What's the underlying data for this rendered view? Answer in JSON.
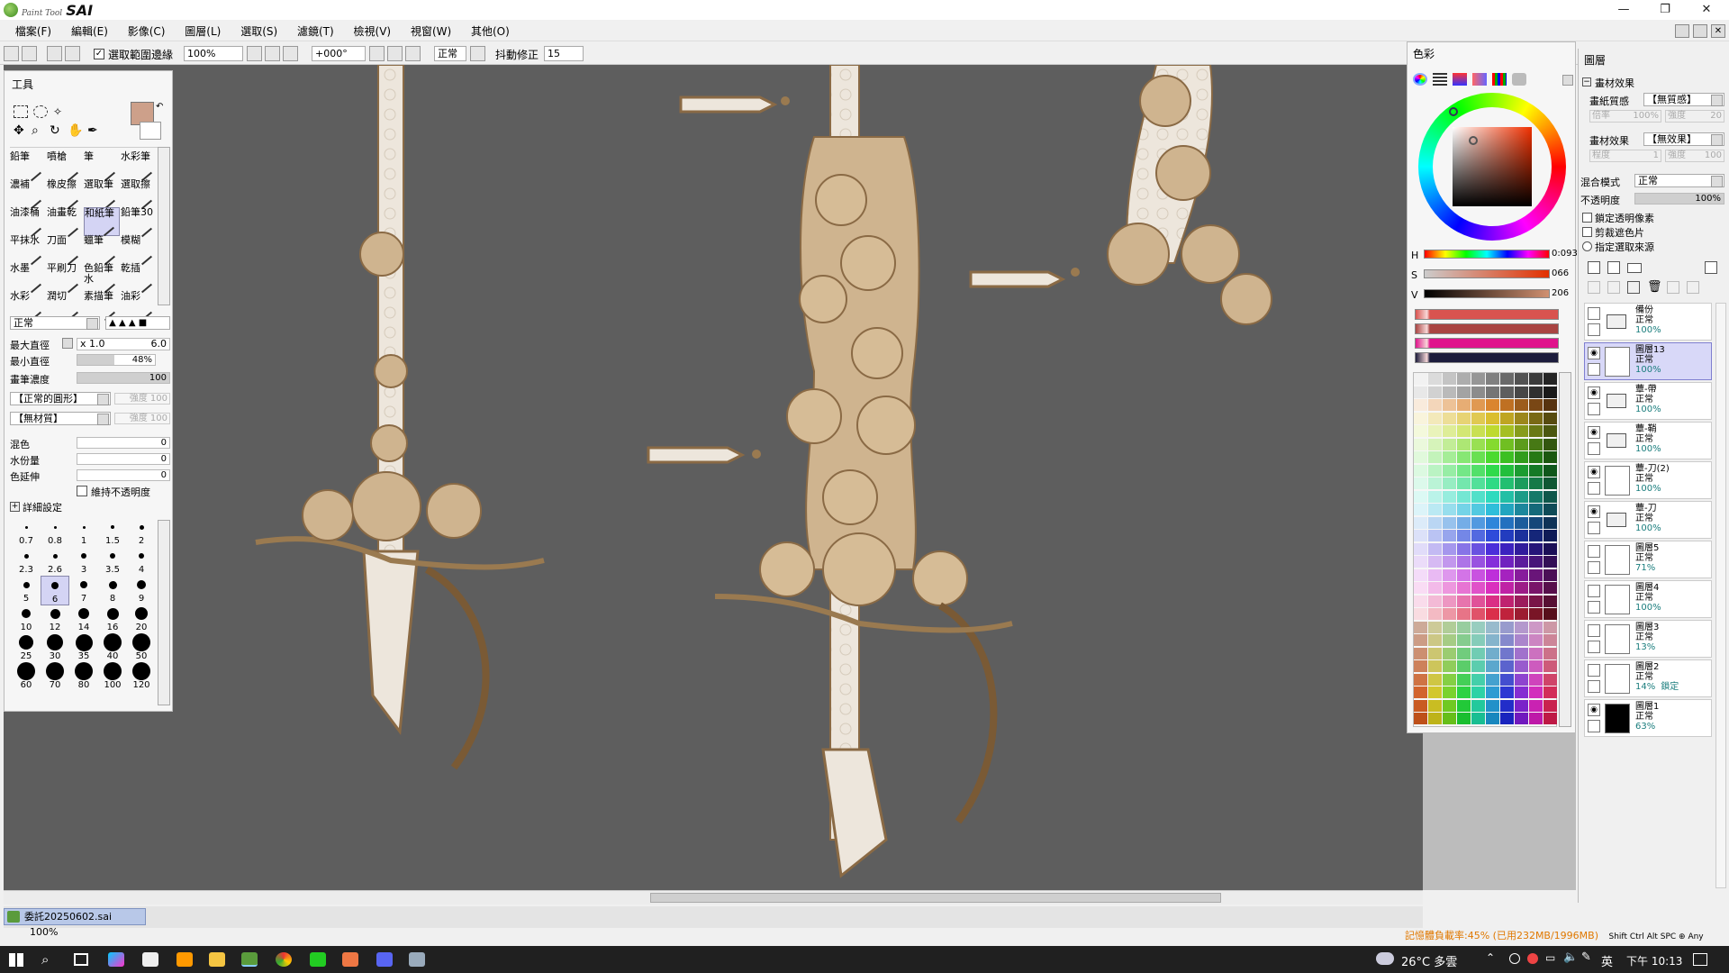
{
  "app": {
    "logo_small": "Paint Tool",
    "logo_big": "SAI"
  },
  "window_buttons": [
    "—",
    "❐",
    "✕"
  ],
  "menu": [
    "檔案(F)",
    "編輯(E)",
    "影像(C)",
    "圖層(L)",
    "選取(S)",
    "濾鏡(T)",
    "檢視(V)",
    "視窗(W)",
    "其他(O)"
  ],
  "toolbar": {
    "antialias_label": "選取範圍邊緣",
    "zoom": "100%",
    "rotation": "+000°",
    "blend_mode": "正常",
    "stabilizer_label": "抖動修正",
    "stabilizer_value": "15"
  },
  "tool_panel": {
    "title": "工具",
    "brushes": [
      "鉛筆",
      "噴槍",
      "筆",
      "水彩筆",
      "濃補",
      "橡皮擦",
      "選取筆",
      "選取擦",
      "油漆桶",
      "油畫乾",
      "和紙筆",
      "鉛筆30",
      "平抹水",
      "刀面",
      "蠟筆",
      "模糊",
      "水墨",
      "平刷刀",
      "色鉛筆水",
      "乾插",
      "水彩",
      "潤切",
      "素描筆",
      "油彩"
    ],
    "brush_mode": "正常",
    "max_size_label": "最大直徑",
    "max_size_mult": "x 1.0",
    "max_size_value": "6.0",
    "min_size_label": "最小直徑",
    "min_size_value": "48%",
    "min_size_fraction": 0.48,
    "density_label": "畫筆濃度",
    "density_value": "100",
    "shape_label": "【正常的圓形】",
    "shape_strength": "強度 100",
    "texture_label": "【無材質】",
    "texture_strength": "強度 100",
    "blend_label": "混色",
    "blend_value": "0",
    "water_label": "水份量",
    "water_value": "0",
    "persist_label": "色延伸",
    "persist_value": "0",
    "keep_opacity_label": "維持不透明度",
    "detail_label": "詳細設定",
    "sizes": [
      "0.7",
      "0.8",
      "1",
      "1.5",
      "2",
      "2.3",
      "2.6",
      "3",
      "3.5",
      "4",
      "5",
      "6",
      "7",
      "8",
      "9",
      "10",
      "12",
      "14",
      "16",
      "20",
      "25",
      "30",
      "35",
      "40",
      "50",
      "60",
      "70",
      "80",
      "100",
      "120"
    ]
  },
  "color_panel": {
    "title": "色彩",
    "h_label": "H",
    "h_value": "0:093",
    "s_label": "S",
    "s_value": "066",
    "v_label": "V",
    "v_value": "206",
    "current_color": "#cda08a",
    "rows": [
      "#d9534f",
      "#a94442",
      "#e0148c",
      "#1c1c3c"
    ]
  },
  "layer_panel": {
    "title": "圖層",
    "effects_label": "畫材效果",
    "paper_label": "畫紙質感",
    "paper_value": "【無質感】",
    "paper_scale": "倍率",
    "paper_scale_value": "100%",
    "paper_strength": "強度",
    "paper_strength_value": "20",
    "effect_label": "畫材效果",
    "effect_value": "【無效果】",
    "effect_degree": "程度",
    "effect_degree_value": "1",
    "effect_strength": "強度",
    "effect_strength_value": "100",
    "blend_mode_label": "混合模式",
    "blend_mode_value": "正常",
    "opacity_label": "不透明度",
    "opacity_value": "100%",
    "opt_lock_alpha": "鎖定透明像素",
    "opt_clip": "剪裁遮色片",
    "opt_selection_source": "指定選取來源",
    "layers": [
      {
        "name": "備份",
        "mode": "正常",
        "opacity": "100%",
        "folder": true,
        "visible": false
      },
      {
        "name": "圖層13",
        "mode": "正常",
        "opacity": "100%",
        "folder": false,
        "visible": true,
        "selected": true
      },
      {
        "name": "蕈-帶",
        "mode": "正常",
        "opacity": "100%",
        "folder": true,
        "visible": true
      },
      {
        "name": "蕈-鞘",
        "mode": "正常",
        "opacity": "100%",
        "folder": true,
        "visible": true
      },
      {
        "name": "蕈-刀(2)",
        "mode": "正常",
        "opacity": "100%",
        "folder": false,
        "visible": true
      },
      {
        "name": "蕈-刀",
        "mode": "正常",
        "opacity": "100%",
        "folder": true,
        "visible": true
      },
      {
        "name": "圖層5",
        "mode": "正常",
        "opacity": "71%",
        "folder": false,
        "visible": false
      },
      {
        "name": "圖層4",
        "mode": "正常",
        "opacity": "100%",
        "folder": false,
        "visible": false
      },
      {
        "name": "圖層3",
        "mode": "正常",
        "opacity": "13%",
        "folder": false,
        "visible": false
      },
      {
        "name": "圖層2",
        "mode": "正常",
        "opacity": "14%",
        "folder": false,
        "visible": false,
        "locked_label": "鎖定"
      },
      {
        "name": "圖層1",
        "mode": "正常",
        "opacity": "63%",
        "folder": false,
        "visible": true,
        "black": true
      }
    ]
  },
  "document_tab": {
    "name": "委託20250602.sai",
    "zoom": "100%"
  },
  "status": {
    "memory": "記憶體負載率:45% (已用232MB/1996MB)",
    "keys": "Shift Ctrl Alt SPC ⊕ Any"
  },
  "taskbar": {
    "weather": "26°C 多雲",
    "ime": "英",
    "time": "下午 10:13"
  }
}
